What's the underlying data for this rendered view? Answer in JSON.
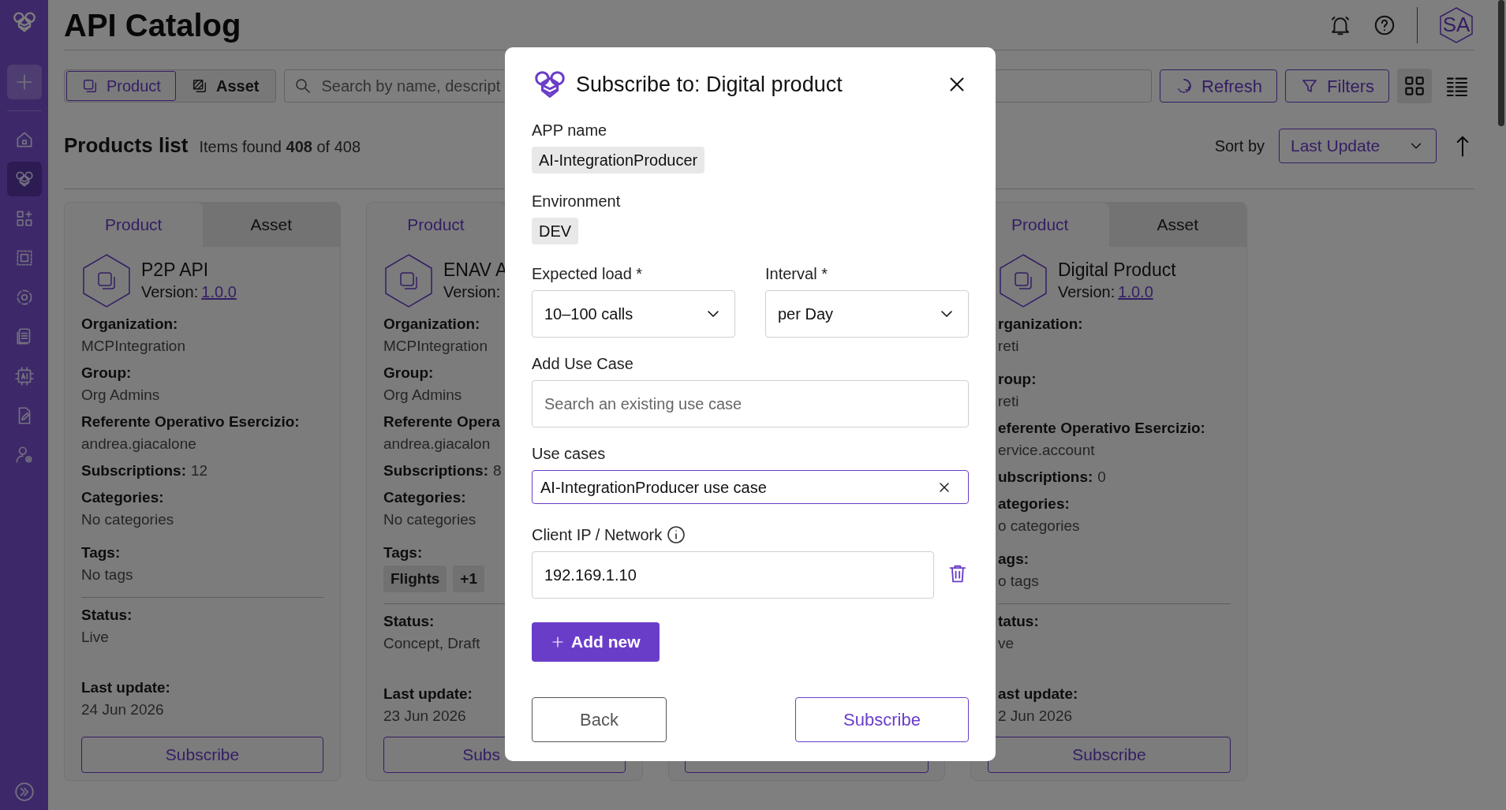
{
  "nav_items": [
    {
      "kind": "add",
      "selected": false
    },
    {
      "kind": "home",
      "selected": false
    },
    {
      "kind": "bee",
      "selected": true
    },
    {
      "kind": "apps",
      "selected": false
    },
    {
      "kind": "select",
      "selected": false
    },
    {
      "kind": "target",
      "selected": false
    },
    {
      "kind": "docs",
      "selected": false
    },
    {
      "kind": "ai",
      "selected": false
    },
    {
      "kind": "edit",
      "selected": false
    },
    {
      "kind": "users",
      "selected": false
    }
  ],
  "header": {
    "title": "API Catalog",
    "avatar": "SA"
  },
  "toolbar": {
    "view_toggle": [
      {
        "label": "Product",
        "kind": "product",
        "selected": true
      },
      {
        "label": "Asset",
        "kind": "asset",
        "selected": false
      }
    ],
    "search": {
      "placeholder": "Search by name, descript"
    },
    "buttons": [
      {
        "label": "Refresh",
        "kind": "refresh"
      },
      {
        "label": "Filters",
        "kind": "filter"
      }
    ],
    "layouts": [
      {
        "kind": "grid",
        "selected": true
      },
      {
        "kind": "list",
        "selected": false
      }
    ]
  },
  "list": {
    "title": "Products list",
    "count": "Items found **408** of 408",
    "sort_label": "Sort by",
    "sort_value": "Last Update"
  },
  "cards": [
    {
      "kind": "full",
      "tabs": [
        {
          "label": "Product",
          "selected": true
        },
        {
          "label": "Asset",
          "selected": false
        }
      ],
      "name": "P2P API",
      "version_label": "Version:",
      "version": "1.0.0",
      "details": [
        {
          "kind": "stacked",
          "label": "Organization:",
          "value": "MCPIntegration"
        },
        {
          "kind": "stacked",
          "label": "Group:",
          "value": "Org Admins"
        },
        {
          "kind": "stacked",
          "label": "Referente Operativo Esercizio:",
          "value": "andrea.giacalone"
        },
        {
          "kind": "inline",
          "label": "Subscriptions:",
          "value": "12"
        },
        {
          "kind": "stacked",
          "label": "Categories:",
          "value": "No categories"
        },
        {
          "kind": "stacked",
          "label": "Tags:",
          "value": "No tags"
        }
      ],
      "footer": [
        {
          "label": "Status:",
          "value": "Live"
        },
        {
          "label": "Last update:",
          "value": "24 Jun 2026"
        }
      ],
      "button": "Subscribe"
    },
    {
      "kind": "partial_right",
      "tabs": [
        {
          "label": "Product",
          "selected": true
        }
      ],
      "name": "ENAV A",
      "version_label": "Version:",
      "details": [
        {
          "kind": "stacked",
          "label": "Organization:",
          "value": "MCPIntegration"
        },
        {
          "kind": "stacked",
          "label": "Group:",
          "value": "Org Admins"
        },
        {
          "kind": "stacked",
          "label": "Referente Opera",
          "value": "andrea.giacalon"
        },
        {
          "kind": "inline",
          "label": "Subscriptions:",
          "value": "8"
        },
        {
          "kind": "stacked",
          "label": "Categories:",
          "value": "No categories"
        },
        {
          "kind": "tags",
          "label": "Tags:",
          "tags": [
            "Flights",
            "+1"
          ]
        }
      ],
      "footer": [
        {
          "label": "Status:",
          "value": "Concept, Draft"
        },
        {
          "label": "Last update:",
          "value": "23 Jun 2026"
        }
      ],
      "button": "Subs"
    },
    {
      "kind": "hidden"
    },
    {
      "kind": "partial_left",
      "tabs": [
        {
          "label": "Product",
          "selected": true
        },
        {
          "label": "Asset",
          "selected": false
        }
      ],
      "name": "Digital Product",
      "version_label": "Version:",
      "version": "1.0.0",
      "details": [
        {
          "kind": "stacked",
          "label": "rganization:",
          "value": "reti"
        },
        {
          "kind": "stacked",
          "label": "roup:",
          "value": "reti"
        },
        {
          "kind": "stacked",
          "label": "eferente Operativo Esercizio:",
          "value": "ervice.account"
        },
        {
          "kind": "inline",
          "label": "ubscriptions:",
          "value": "0"
        },
        {
          "kind": "stacked",
          "label": "ategories:",
          "value": "o categories"
        },
        {
          "kind": "stacked",
          "label": "ags:",
          "value": "o tags"
        }
      ],
      "footer": [
        {
          "label": "tatus:",
          "value": "ve"
        },
        {
          "label": "ast update:",
          "value": "2 Jun 2026"
        }
      ],
      "button": "Subscribe"
    }
  ],
  "dialog": {
    "title": "Subscribe to: Digital product",
    "app_name": {
      "label": "APP name",
      "value": "AI-IntegrationProducer"
    },
    "environment": {
      "label": "Environment",
      "value": "DEV"
    },
    "expected_load": {
      "label": "Expected load *",
      "value": "10–100 calls"
    },
    "interval": {
      "label": "Interval *",
      "value": "per Day"
    },
    "add_use_case": {
      "label": "Add Use Case",
      "placeholder": "Search an existing use case"
    },
    "use_cases": {
      "label": "Use cases",
      "value": "AI-IntegrationProducer use case"
    },
    "client_ip": {
      "label": "Client IP / Network",
      "value": "192.169.1.10"
    },
    "add_button": "Add new",
    "back_button": "Back",
    "subscribe_button": "Subscribe"
  }
}
